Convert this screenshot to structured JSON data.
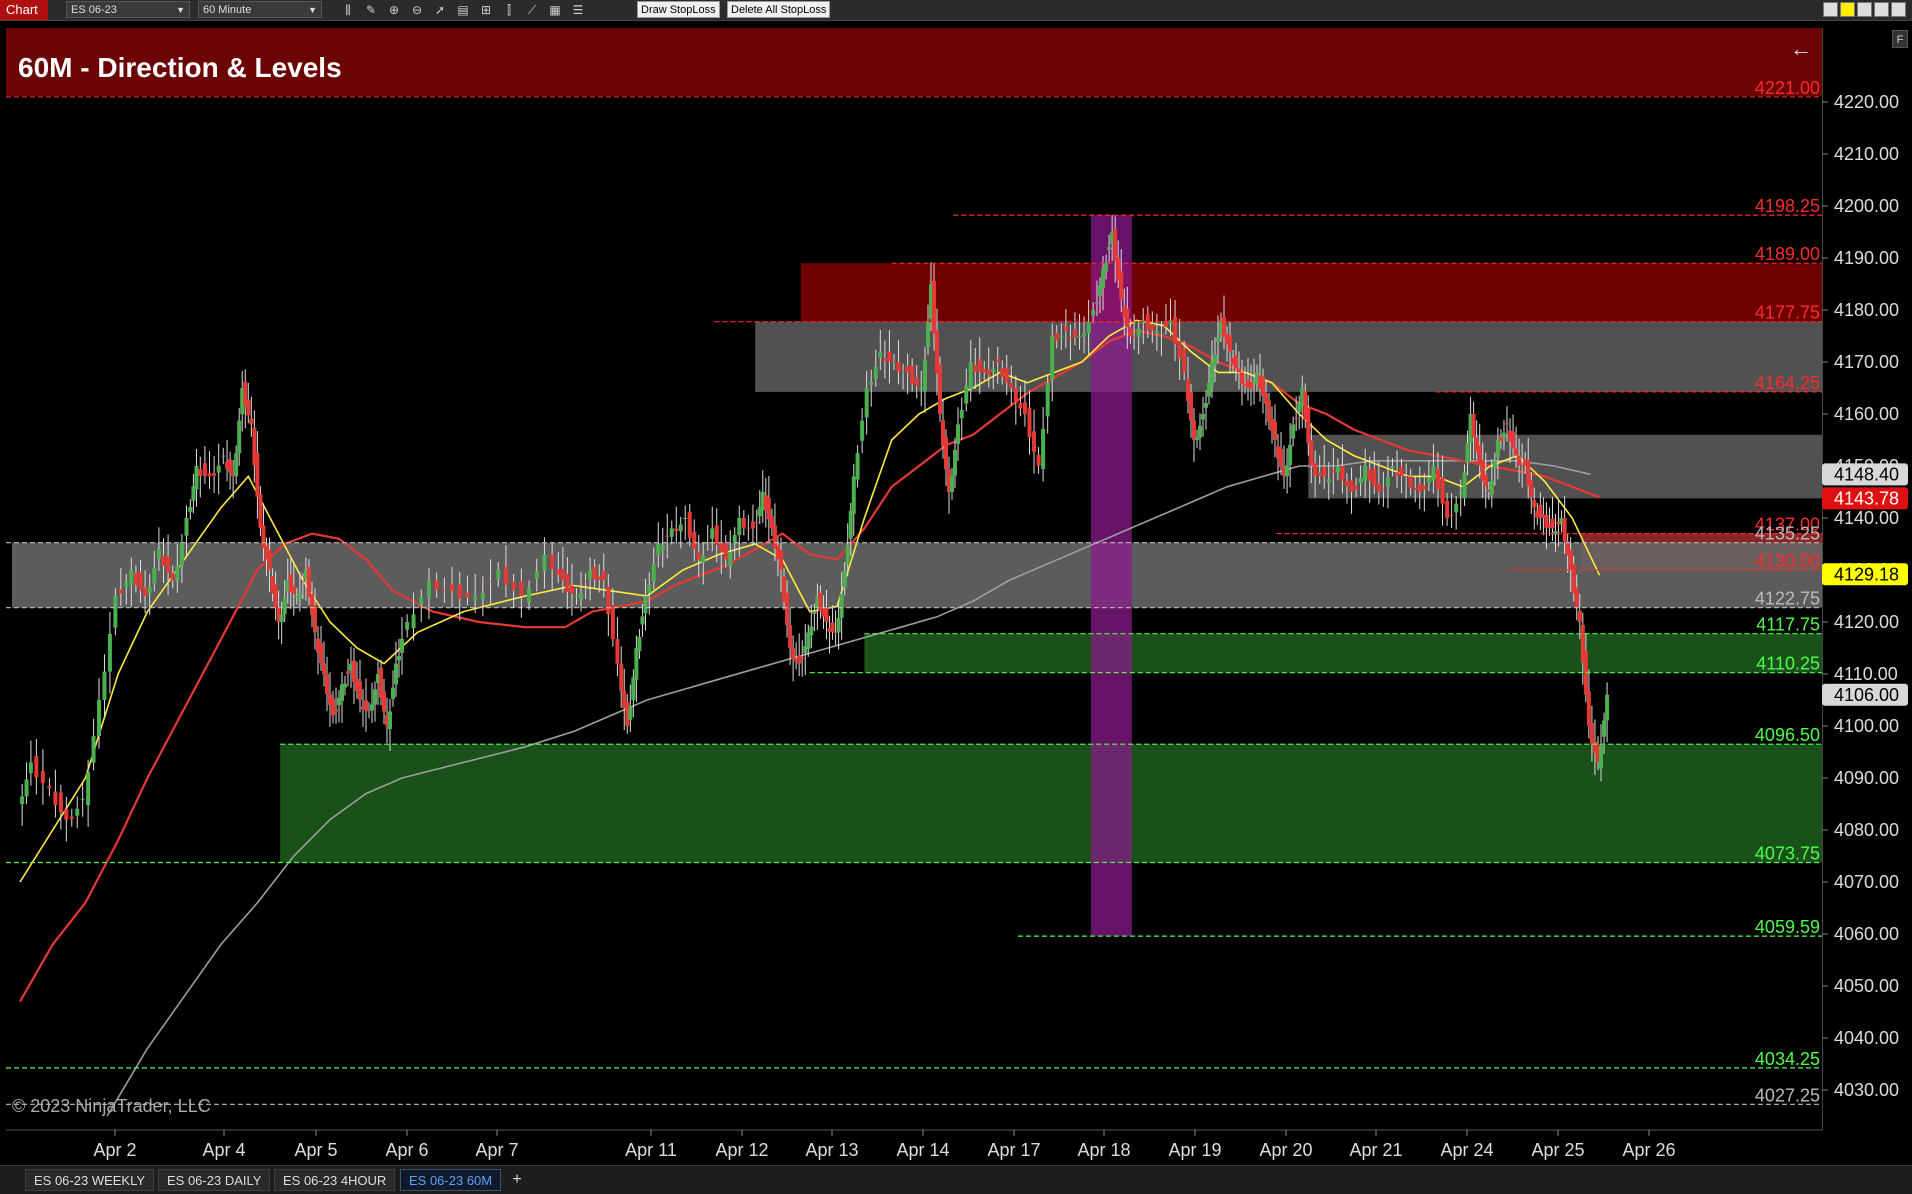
{
  "toolbar": {
    "chart_tab": "Chart",
    "instrument": "ES 06-23",
    "interval": "60 Minute",
    "buttons": [
      "Draw StopLoss",
      "Delete All StopLoss"
    ],
    "icons": [
      "bar-type-icon",
      "draw-tool-icon",
      "zoom-in-icon",
      "zoom-out-icon",
      "pointer-icon",
      "data-box-icon",
      "chart-trader-icon",
      "indicators-icon",
      "strategies-icon",
      "properties-icon",
      "templates-icon"
    ]
  },
  "chart": {
    "title": "60M - Direction & Levels",
    "copyright": "© 2023 NinjaTrader, LLC",
    "colors": {
      "title_band": "#6b0505",
      "bull_candle": "#4caf50",
      "bear_candle": "#e53935",
      "sma_yellow": "#ffeb3b",
      "sma_red": "#e53935",
      "sma_gray": "#9e9e9e",
      "resistance": "#e53935",
      "support": "#4caf50"
    }
  },
  "chart_data": {
    "type": "candlestick",
    "instrument": "ES 06-23",
    "interval": "60 Minute",
    "ylim": [
      4025,
      4227
    ],
    "price_ticks": [
      "4030.00",
      "4040.00",
      "4050.00",
      "4060.00",
      "4070.00",
      "4080.00",
      "4090.00",
      "4100.00",
      "4110.00",
      "4120.00",
      "4130.00",
      "4140.00",
      "4150.00",
      "4160.00",
      "4170.00",
      "4180.00",
      "4190.00",
      "4200.00",
      "4210.00",
      "4220.00"
    ],
    "date_labels": [
      "Apr 2",
      "Apr 4",
      "Apr 5",
      "Apr 6",
      "Apr 7",
      "Apr 11",
      "Apr 12",
      "Apr 13",
      "Apr 14",
      "Apr 17",
      "Apr 18",
      "Apr 19",
      "Apr 20",
      "Apr 21",
      "Apr 24",
      "Apr 25",
      "Apr 26"
    ],
    "levels": [
      {
        "price": 4221.0,
        "label": "4221.00",
        "color": "#ff2a2a",
        "from_date": 0.0
      },
      {
        "price": 4198.25,
        "label": "4198.25",
        "color": "#ff2a2a",
        "from_date": 9.38
      },
      {
        "price": 4189.0,
        "label": "4189.00",
        "color": "#ff2a2a",
        "from_date": 8.7
      },
      {
        "price": 4177.75,
        "label": "4177.75",
        "color": "#ff2a2a",
        "from_date": 6.75
      },
      {
        "price": 4164.25,
        "label": "4164.25",
        "color": "#ff2a2a",
        "from_date": 14.7
      },
      {
        "price": 4137.0,
        "label": "4137.00",
        "color": "#ff2a2a",
        "from_date": 12.95
      },
      {
        "price": 4135.25,
        "label": "4135.25",
        "color": "#bbbbbb",
        "from_date": 0.0
      },
      {
        "price": 4130.0,
        "label": "4130.00",
        "color": "#ff2a2a",
        "from_date": 15.5
      },
      {
        "price": 4122.75,
        "label": "4122.75",
        "color": "#bbbbbb",
        "from_date": 0.0
      },
      {
        "price": 4117.75,
        "label": "4117.75",
        "color": "#4cff4c",
        "from_date": 8.4
      },
      {
        "price": 4110.25,
        "label": "4110.25",
        "color": "#4cff4c",
        "from_date": 7.8
      },
      {
        "price": 4096.5,
        "label": "4096.50",
        "color": "#4cff4c",
        "from_date": 2.65
      },
      {
        "price": 4073.75,
        "label": "4073.75",
        "color": "#4cff4c",
        "from_date": 0.0
      },
      {
        "price": 4059.59,
        "label": "4059.59",
        "color": "#4cff4c",
        "from_date": 10.1
      },
      {
        "price": 4034.25,
        "label": "4034.25",
        "color": "#4cff4c",
        "from_date": 0.0
      },
      {
        "price": 4027.25,
        "label": "4027.25",
        "color": "#bbbbbb",
        "from_date": 0.0
      }
    ],
    "zones": [
      {
        "name": "upper-resistance-zone",
        "from": 4177.75,
        "to": 4189.0,
        "color": "#7a0000",
        "start_date": 7.7
      },
      {
        "name": "gray-resistance-zone",
        "from": 4164.25,
        "to": 4177.75,
        "color": "#5a5a5a",
        "start_date": 7.2
      },
      {
        "name": "gray-mid-zone",
        "from": 4143.78,
        "to": 4156.0,
        "color": "#5a5a5a",
        "start_date": 13.3
      },
      {
        "name": "red-small-zone",
        "from": 4130.0,
        "to": 4137.0,
        "color": "#9a2a2a",
        "start_date": 16.3
      },
      {
        "name": "gray-support-zone",
        "from": 4122.75,
        "to": 4135.25,
        "color": "#666666",
        "start_date": 0.0
      },
      {
        "name": "green-upper-zone",
        "from": 4110.25,
        "to": 4117.75,
        "color": "#1d5a1d",
        "start_date": 8.4
      },
      {
        "name": "green-lower-zone",
        "from": 4073.75,
        "to": 4096.5,
        "color": "#1d5a1d",
        "start_date": 2.65
      }
    ],
    "vertical_band": {
      "date_from": 10.9,
      "date_to": 11.35,
      "price_top": 4198.25,
      "price_bottom": 4059.59,
      "color": "#8a1a8a"
    },
    "price_markers": [
      {
        "price": 4148.4,
        "label": "4148.40",
        "bg": "#d8d8d8",
        "fg": "#000000"
      },
      {
        "price": 4143.78,
        "label": "4143.78",
        "bg": "#e01010",
        "fg": "#ffffff"
      },
      {
        "price": 4129.18,
        "label": "4129.18",
        "bg": "#ffff00",
        "fg": "#000000"
      },
      {
        "price": 4106.0,
        "label": "4106.00",
        "bg": "#d8d8d8",
        "fg": "#000000"
      }
    ],
    "price_path": [
      [
        0.0,
        4085
      ],
      [
        0.12,
        4093
      ],
      [
        0.3,
        4088
      ],
      [
        0.45,
        4082
      ],
      [
        0.6,
        4086
      ],
      [
        0.75,
        4105
      ],
      [
        0.9,
        4125
      ],
      [
        1.05,
        4130
      ],
      [
        1.2,
        4125
      ],
      [
        1.35,
        4134
      ],
      [
        1.5,
        4128
      ],
      [
        1.65,
        4140
      ],
      [
        1.75,
        4150
      ],
      [
        1.9,
        4148
      ],
      [
        2.05,
        4152
      ],
      [
        2.15,
        4148
      ],
      [
        2.25,
        4165
      ],
      [
        2.35,
        4158
      ],
      [
        2.45,
        4138
      ],
      [
        2.55,
        4130
      ],
      [
        2.65,
        4120
      ],
      [
        2.75,
        4128
      ],
      [
        2.85,
        4125
      ],
      [
        2.95,
        4130
      ],
      [
        3.05,
        4118
      ],
      [
        3.15,
        4110
      ],
      [
        3.25,
        4102
      ],
      [
        3.35,
        4108
      ],
      [
        3.45,
        4112
      ],
      [
        3.55,
        4105
      ],
      [
        3.65,
        4103
      ],
      [
        3.75,
        4110
      ],
      [
        3.85,
        4100
      ],
      [
        3.95,
        4112
      ],
      [
        4.05,
        4120
      ],
      [
        4.2,
        4128
      ],
      [
        4.35,
        4126
      ],
      [
        4.5,
        4125
      ],
      [
        4.65,
        4130
      ],
      [
        4.8,
        4125
      ],
      [
        4.95,
        4133
      ],
      [
        5.1,
        4128
      ],
      [
        5.25,
        4125
      ],
      [
        5.4,
        4130
      ],
      [
        5.55,
        4128
      ],
      [
        5.7,
        4112
      ],
      [
        5.8,
        4100
      ],
      [
        5.9,
        4115
      ],
      [
        6.0,
        4125
      ],
      [
        6.15,
        4135
      ],
      [
        6.3,
        4138
      ],
      [
        6.45,
        4140
      ],
      [
        6.6,
        4132
      ],
      [
        6.75,
        4138
      ],
      [
        6.9,
        4132
      ],
      [
        7.05,
        4140
      ],
      [
        7.2,
        4138
      ],
      [
        7.3,
        4145
      ],
      [
        7.4,
        4138
      ],
      [
        7.5,
        4130
      ],
      [
        7.6,
        4115
      ],
      [
        7.7,
        4112
      ],
      [
        7.8,
        4118
      ],
      [
        7.9,
        4125
      ],
      [
        8.0,
        4120
      ],
      [
        8.1,
        4118
      ],
      [
        8.2,
        4130
      ],
      [
        8.3,
        4148
      ],
      [
        8.45,
        4165
      ],
      [
        8.6,
        4172
      ],
      [
        8.75,
        4170
      ],
      [
        8.9,
        4168
      ],
      [
        9.05,
        4165
      ],
      [
        9.15,
        4185
      ],
      [
        9.25,
        4160
      ],
      [
        9.35,
        4145
      ],
      [
        9.45,
        4158
      ],
      [
        9.6,
        4170
      ],
      [
        9.75,
        4168
      ],
      [
        9.9,
        4170
      ],
      [
        10.05,
        4165
      ],
      [
        10.2,
        4160
      ],
      [
        10.35,
        4150
      ],
      [
        10.5,
        4175
      ],
      [
        10.65,
        4176
      ],
      [
        10.8,
        4175
      ],
      [
        10.95,
        4180
      ],
      [
        11.05,
        4188
      ],
      [
        11.15,
        4195
      ],
      [
        11.25,
        4182
      ],
      [
        11.35,
        4175
      ],
      [
        11.5,
        4178
      ],
      [
        11.65,
        4176
      ],
      [
        11.8,
        4178
      ],
      [
        11.95,
        4168
      ],
      [
        12.05,
        4155
      ],
      [
        12.15,
        4160
      ],
      [
        12.25,
        4170
      ],
      [
        12.35,
        4178
      ],
      [
        12.45,
        4172
      ],
      [
        12.55,
        4168
      ],
      [
        12.65,
        4165
      ],
      [
        12.75,
        4168
      ],
      [
        12.85,
        4162
      ],
      [
        12.95,
        4155
      ],
      [
        13.05,
        4148
      ],
      [
        13.15,
        4158
      ],
      [
        13.25,
        4165
      ],
      [
        13.35,
        4150
      ],
      [
        13.5,
        4148
      ],
      [
        13.65,
        4150
      ],
      [
        13.8,
        4145
      ],
      [
        13.95,
        4150
      ],
      [
        14.1,
        4145
      ],
      [
        14.25,
        4150
      ],
      [
        14.4,
        4148
      ],
      [
        14.55,
        4145
      ],
      [
        14.7,
        4150
      ],
      [
        14.85,
        4140
      ],
      [
        15.0,
        4145
      ],
      [
        15.1,
        4160
      ],
      [
        15.2,
        4150
      ],
      [
        15.3,
        4145
      ],
      [
        15.4,
        4155
      ],
      [
        15.5,
        4158
      ],
      [
        15.6,
        4152
      ],
      [
        15.7,
        4150
      ],
      [
        15.8,
        4142
      ],
      [
        15.9,
        4140
      ],
      [
        16.0,
        4138
      ],
      [
        16.1,
        4140
      ],
      [
        16.2,
        4130
      ],
      [
        16.3,
        4120
      ],
      [
        16.4,
        4100
      ],
      [
        16.5,
        4093
      ],
      [
        16.6,
        4106
      ]
    ],
    "sma_yellow": [
      [
        0.0,
        4070
      ],
      [
        0.3,
        4080
      ],
      [
        0.6,
        4090
      ],
      [
        0.9,
        4110
      ],
      [
        1.2,
        4122
      ],
      [
        1.6,
        4132
      ],
      [
        2.0,
        4142
      ],
      [
        2.3,
        4148
      ],
      [
        2.6,
        4138
      ],
      [
        2.9,
        4128
      ],
      [
        3.2,
        4120
      ],
      [
        3.5,
        4115
      ],
      [
        3.8,
        4112
      ],
      [
        4.1,
        4118
      ],
      [
        4.4,
        4122
      ],
      [
        4.8,
        4125
      ],
      [
        5.2,
        4127
      ],
      [
        5.6,
        4126
      ],
      [
        6.0,
        4125
      ],
      [
        6.4,
        4130
      ],
      [
        6.8,
        4133
      ],
      [
        7.2,
        4135
      ],
      [
        7.5,
        4132
      ],
      [
        7.8,
        4122
      ],
      [
        8.1,
        4123
      ],
      [
        8.4,
        4140
      ],
      [
        8.7,
        4155
      ],
      [
        9.0,
        4160
      ],
      [
        9.3,
        4163
      ],
      [
        9.6,
        4165
      ],
      [
        9.9,
        4168
      ],
      [
        10.2,
        4166
      ],
      [
        10.5,
        4168
      ],
      [
        10.8,
        4170
      ],
      [
        11.1,
        4175
      ],
      [
        11.4,
        4178
      ],
      [
        11.7,
        4177
      ],
      [
        12.0,
        4172
      ],
      [
        12.3,
        4168
      ],
      [
        12.6,
        4168
      ],
      [
        12.9,
        4166
      ],
      [
        13.2,
        4160
      ],
      [
        13.5,
        4155
      ],
      [
        13.8,
        4152
      ],
      [
        14.1,
        4150
      ],
      [
        14.4,
        4148
      ],
      [
        14.7,
        4148
      ],
      [
        15.0,
        4146
      ],
      [
        15.3,
        4150
      ],
      [
        15.6,
        4152
      ],
      [
        15.9,
        4147
      ],
      [
        16.2,
        4140
      ],
      [
        16.5,
        4129
      ]
    ],
    "sma_red": [
      [
        0.0,
        4047
      ],
      [
        0.3,
        4058
      ],
      [
        0.6,
        4066
      ],
      [
        0.9,
        4078
      ],
      [
        1.2,
        4090
      ],
      [
        1.5,
        4100
      ],
      [
        1.8,
        4110
      ],
      [
        2.1,
        4120
      ],
      [
        2.4,
        4130
      ],
      [
        2.7,
        4135
      ],
      [
        3.0,
        4137
      ],
      [
        3.3,
        4136
      ],
      [
        3.6,
        4132
      ],
      [
        3.9,
        4126
      ],
      [
        4.2,
        4122
      ],
      [
        4.5,
        4120
      ],
      [
        4.8,
        4119
      ],
      [
        5.1,
        4119
      ],
      [
        5.4,
        4122
      ],
      [
        5.7,
        4123
      ],
      [
        6.0,
        4124
      ],
      [
        6.3,
        4127
      ],
      [
        6.6,
        4129
      ],
      [
        6.9,
        4131
      ],
      [
        7.2,
        4134
      ],
      [
        7.5,
        4137
      ],
      [
        7.8,
        4133
      ],
      [
        8.1,
        4132
      ],
      [
        8.4,
        4138
      ],
      [
        8.7,
        4146
      ],
      [
        9.0,
        4150
      ],
      [
        9.3,
        4154
      ],
      [
        9.6,
        4156
      ],
      [
        9.9,
        4160
      ],
      [
        10.2,
        4164
      ],
      [
        10.5,
        4167
      ],
      [
        10.8,
        4170
      ],
      [
        11.1,
        4174
      ],
      [
        11.4,
        4176
      ],
      [
        11.7,
        4175
      ],
      [
        12.0,
        4173
      ],
      [
        12.3,
        4170
      ],
      [
        12.6,
        4168
      ],
      [
        12.9,
        4166
      ],
      [
        13.2,
        4162
      ],
      [
        13.5,
        4160
      ],
      [
        13.8,
        4157
      ],
      [
        14.1,
        4155
      ],
      [
        14.4,
        4153
      ],
      [
        14.7,
        4152
      ],
      [
        15.0,
        4151
      ],
      [
        15.3,
        4150
      ],
      [
        15.6,
        4149
      ],
      [
        15.9,
        4148
      ],
      [
        16.2,
        4146
      ],
      [
        16.5,
        4144
      ]
    ],
    "sma_gray": [
      [
        0.8,
        4025
      ],
      [
        1.2,
        4038
      ],
      [
        1.6,
        4048
      ],
      [
        2.0,
        4058
      ],
      [
        2.4,
        4066
      ],
      [
        2.8,
        4075
      ],
      [
        3.2,
        4082
      ],
      [
        3.6,
        4087
      ],
      [
        4.0,
        4090
      ],
      [
        4.4,
        4093
      ],
      [
        4.8,
        4096
      ],
      [
        5.2,
        4099
      ],
      [
        5.6,
        4102
      ],
      [
        6.0,
        4105
      ],
      [
        6.4,
        4107
      ],
      [
        6.8,
        4109
      ],
      [
        7.2,
        4111
      ],
      [
        7.6,
        4113
      ],
      [
        8.0,
        4115
      ],
      [
        8.4,
        4117
      ],
      [
        8.8,
        4119
      ],
      [
        9.2,
        4121
      ],
      [
        9.6,
        4124
      ],
      [
        10.0,
        4128
      ],
      [
        10.4,
        4131
      ],
      [
        10.8,
        4134
      ],
      [
        11.2,
        4137
      ],
      [
        11.6,
        4140
      ],
      [
        12.0,
        4143
      ],
      [
        12.4,
        4146
      ],
      [
        12.8,
        4148
      ],
      [
        13.2,
        4150
      ],
      [
        13.6,
        4150
      ],
      [
        14.0,
        4151
      ],
      [
        14.4,
        4151
      ],
      [
        14.8,
        4151
      ],
      [
        15.2,
        4151
      ],
      [
        15.6,
        4151
      ],
      [
        16.0,
        4150
      ],
      [
        16.4,
        4148.4
      ]
    ]
  },
  "bottom_tabs": [
    {
      "label": "ES 06-23 WEEKLY",
      "active": false
    },
    {
      "label": "ES 06-23 DAILY",
      "active": false
    },
    {
      "label": "ES 06-23 4HOUR",
      "active": false
    },
    {
      "label": "ES 06-23 60M",
      "active": true
    }
  ],
  "add_tab_label": "+",
  "axis_button": "F"
}
